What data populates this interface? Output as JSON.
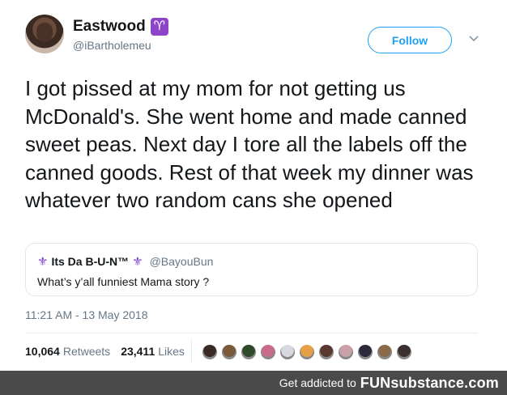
{
  "author": {
    "display_name": "Eastwood",
    "badge_icon": "♈",
    "handle": "@iBartholemeu"
  },
  "actions": {
    "follow_label": "Follow",
    "more_icon": "chevron-down-icon"
  },
  "tweet": {
    "text": "I got pissed at my mom for not getting us McDonald's. She went home and made canned sweet peas. Next day I tore all the labels off the canned goods. Rest of that week my dinner was whatever two random cans she opened",
    "timestamp": "11:21 AM - 13 May 2018"
  },
  "quoted_tweet": {
    "name": "Its Da B-U-N™",
    "handle": "@BayouBun",
    "text": "What’s y’all funniest Mama story ?"
  },
  "stats": {
    "retweets_count": "10,064",
    "retweets_label": "Retweets",
    "likes_count": "23,411",
    "likes_label": "Likes"
  },
  "liker_avatar_colors": [
    "#3a2a24",
    "#7a5a3a",
    "#2f4a2a",
    "#c96b8a",
    "#d8d8e0",
    "#e8a048",
    "#5a3a30",
    "#c9a0a8",
    "#2a2a3a",
    "#8a6a4a",
    "#3a3030"
  ],
  "footer": {
    "prefix": "Get addicted to",
    "brand": "FUNsubstance.com"
  },
  "colors": {
    "accent": "#1da1f2",
    "badge": "#8e44c9",
    "footer_bg": "#4a4a4a"
  }
}
